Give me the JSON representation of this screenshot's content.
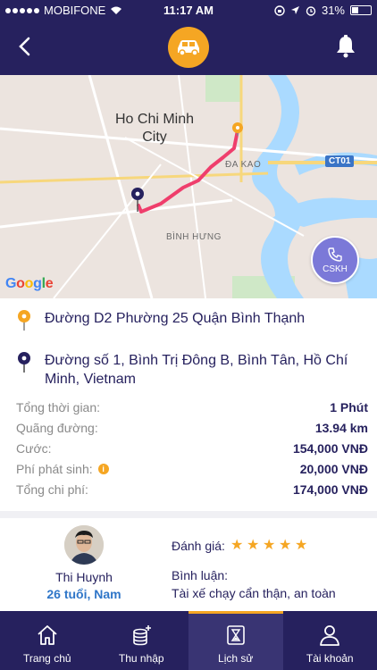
{
  "status_bar": {
    "carrier": "MOBIFONE",
    "time": "11:17 AM",
    "battery": "31%"
  },
  "header": {
    "back_icon": "chevron-left-icon",
    "center_icon": "car-icon",
    "right_icon": "bell-icon"
  },
  "map": {
    "city_label": "Ho Chi Minh City",
    "district_label_1": "ĐA KAO",
    "district_label_2": "BÌNH HƯNG",
    "road_badge": "CT01",
    "attribution": "Google",
    "support_button_label": "CSKH",
    "colors": {
      "route": "#ef3e6c",
      "origin_pin": "#f5a623",
      "destination_pin": "#26215e",
      "water": "#aadaff"
    }
  },
  "trip": {
    "pickup_address": "Đường D2 Phường 25 Quận Bình Thạnh",
    "dropoff_address": "Đường số 1, Bình Trị Đông B, Bình Tân, Hồ Chí Minh, Vietnam"
  },
  "summary": {
    "rows": [
      {
        "label": "Tổng thời gian:",
        "value": "1 Phút"
      },
      {
        "label": "Quãng đường:",
        "value": "13.94 km"
      },
      {
        "label": "Cước:",
        "value": "154,000 VNĐ"
      },
      {
        "label": "Phí phát sinh:",
        "value": "20,000 VNĐ",
        "info": "i"
      },
      {
        "label": "Tổng chi phí:",
        "value": "174,000 VNĐ"
      }
    ]
  },
  "driver": {
    "name": "Thi Huynh",
    "info": "26 tuổi, Nam",
    "rating_label": "Đánh giá:",
    "rating": 5,
    "comment_label": "Bình luận:",
    "comment": "Tài xế chạy cẩn thận, an toàn"
  },
  "tabs": [
    {
      "label": "Trang chủ",
      "icon": "home-icon",
      "active": false
    },
    {
      "label": "Thu nhập",
      "icon": "coins-icon",
      "active": false
    },
    {
      "label": "Lịch sử",
      "icon": "hourglass-icon",
      "active": true
    },
    {
      "label": "Tài khoản",
      "icon": "user-icon",
      "active": false
    }
  ],
  "accent_color": "#f5a623",
  "brand_color": "#26215e"
}
